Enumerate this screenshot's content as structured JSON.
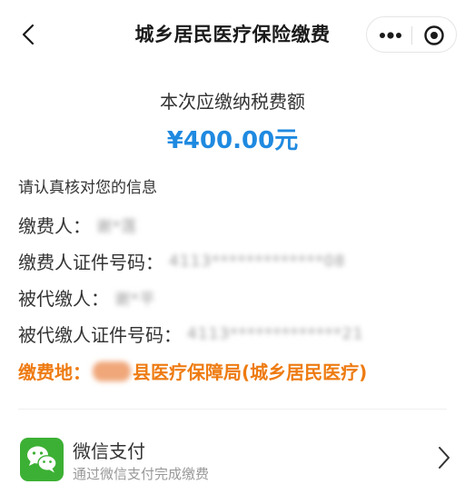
{
  "header": {
    "title": "城乡居民医疗保险缴费",
    "back_icon": "chevron-left-icon",
    "more_icon": "more-dots-icon",
    "close_icon": "target-circle-icon"
  },
  "amount": {
    "label": "本次应缴纳税费额",
    "value": "¥400.00元",
    "color": "#1f8ae0"
  },
  "info": {
    "heading": "请认真核对您的信息",
    "payer_label": "缴费人：",
    "payer_value": "谢*莲",
    "payer_id_label": "缴费人证件号码：",
    "payer_id_value": "4113*************08",
    "insured_label": "被代缴人：",
    "insured_value": "谢*平",
    "insured_id_label": "被代缴人证件号码：",
    "insured_id_value": "4113*************21",
    "place_label": "缴费地：",
    "place_value": "县医疗保障局(城乡居民医疗)",
    "place_color": "#ee7b12"
  },
  "payment": {
    "title": "微信支付",
    "subtitle": "通过微信支付完成缴费",
    "logo_icon": "wechat-icon",
    "logo_color": "#3cb034",
    "arrow_icon": "chevron-right-icon"
  }
}
